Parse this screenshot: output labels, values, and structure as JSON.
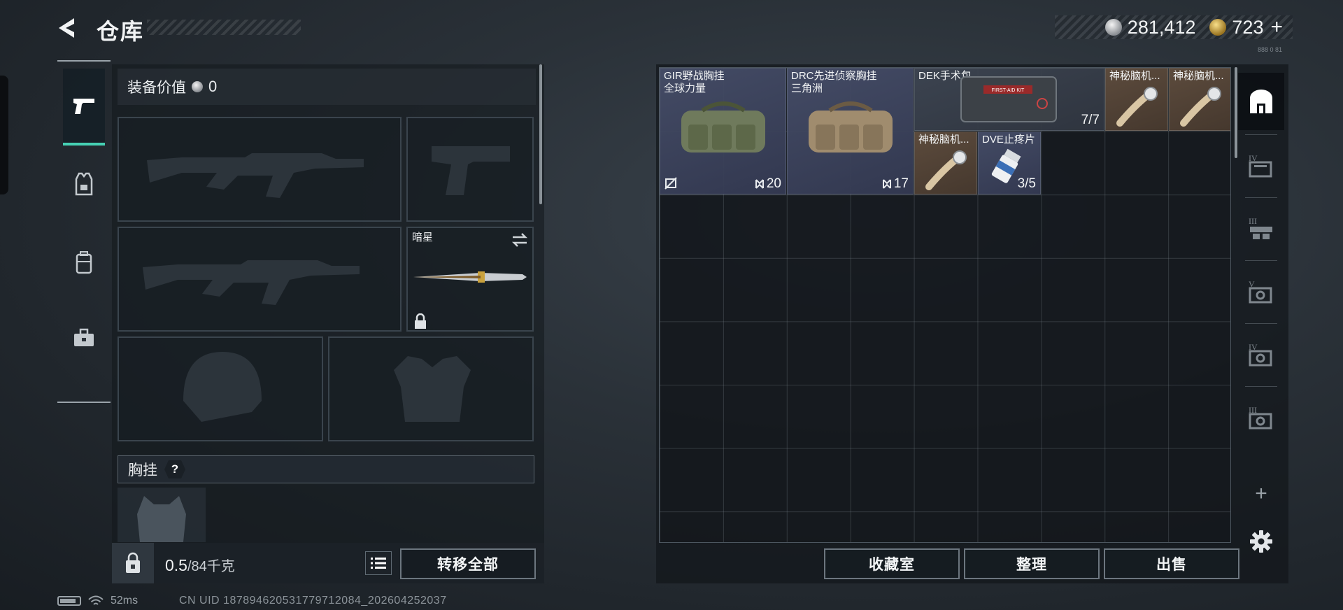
{
  "header": {
    "title": "仓库",
    "currency": [
      {
        "icon": "silver-coin-icon",
        "value": "281,412"
      },
      {
        "icon": "gold-coin-icon",
        "value": "723"
      }
    ],
    "add_symbol": "+",
    "build_id": "888 0 81"
  },
  "equipment": {
    "value_label": "装备价值",
    "value": "0",
    "melee_slot_name": "暗星",
    "chest_rig_section": "胸挂",
    "help_symbol": "?",
    "weight_current": "0.5",
    "weight_total": "/84千克",
    "transfer_all": "转移全部"
  },
  "categories": [
    {
      "name": "weapons",
      "icon": "pistol-icon"
    },
    {
      "name": "armor",
      "icon": "armor-vest-icon"
    },
    {
      "name": "backpack",
      "icon": "backpack-icon"
    },
    {
      "name": "toolbox",
      "icon": "toolbox-icon"
    }
  ],
  "storage": {
    "items": [
      {
        "name1": "GIR野战胸挂",
        "name2": "全球力量",
        "durability": "20",
        "marked_broken": true,
        "bg": "blue"
      },
      {
        "name1": "DRC先进侦察胸挂",
        "name2": "三角洲",
        "durability": "17",
        "bg": "blue"
      },
      {
        "name1": "DEK手术包",
        "name2": "",
        "count": "7/7",
        "bg": "gray",
        "kit_label": "FIRST-AID KIT"
      },
      {
        "name1": "神秘脑机...",
        "bg": "brown"
      },
      {
        "name1": "神秘脑机...",
        "bg": "brown"
      },
      {
        "name1": "神秘脑机...",
        "bg": "brown"
      },
      {
        "name1": "DVE止疼片",
        "count": "3/5",
        "bg": "blue"
      }
    ],
    "buttons": {
      "vault": "收藏室",
      "sort": "整理",
      "sell": "出售"
    }
  },
  "side_tabs": [
    {
      "name": "stash",
      "icon": "stash-icon",
      "active": true
    },
    {
      "name": "container-iv",
      "icon": "container-iv-icon",
      "roman": "IV"
    },
    {
      "name": "container-iii",
      "icon": "container-iii-icon",
      "roman": "III"
    },
    {
      "name": "container-v",
      "icon": "container-v-icon",
      "roman": "V"
    },
    {
      "name": "container-iv-b",
      "icon": "container-iv-b-icon",
      "roman": "IV"
    },
    {
      "name": "container-iii-b",
      "icon": "container-iii-b-icon",
      "roman": "III"
    },
    {
      "name": "add-container",
      "icon": "plus-icon",
      "symbol": "+"
    },
    {
      "name": "settings",
      "icon": "gear-icon"
    }
  ],
  "status": {
    "ping": "52ms",
    "uid": "CN UID 18789462053177971208​4_202604252037"
  },
  "colors": {
    "accent": "#46d1b4"
  }
}
